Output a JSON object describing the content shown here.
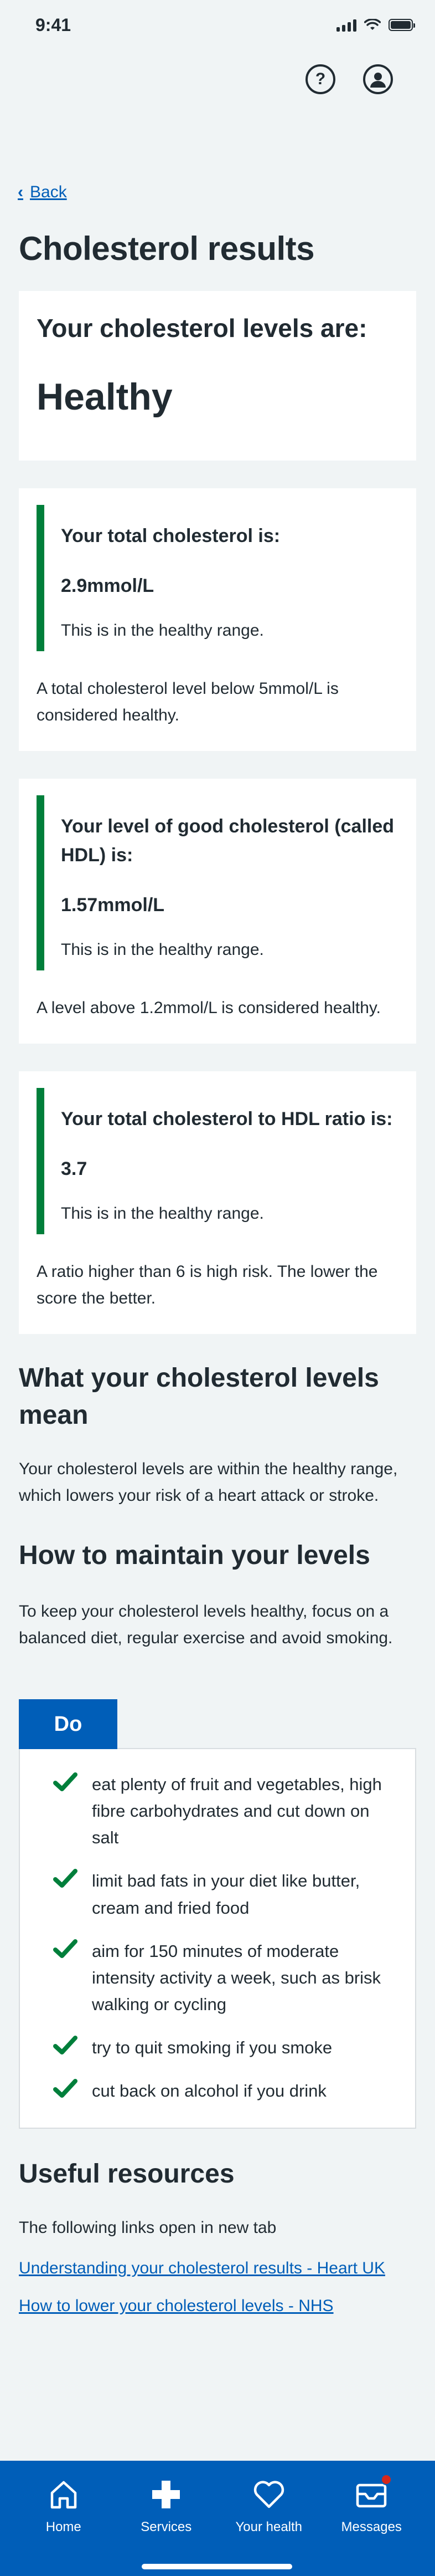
{
  "status_bar": {
    "time": "9:41"
  },
  "header": {
    "help_icon": "question-circle-icon",
    "profile_icon": "user-circle-icon"
  },
  "back": {
    "label": "Back"
  },
  "page_title": "Cholesterol results",
  "summary": {
    "label": "Your cholesterol levels are:",
    "value": "Healthy"
  },
  "results": [
    {
      "title": "Your total cholesterol is:",
      "value": "2.9mmol/L",
      "note": "This is in the healthy range.",
      "footnote": "A total cholesterol level below 5mmol/L is considered healthy."
    },
    {
      "title": "Your level of good cholesterol (called HDL) is:",
      "value": "1.57mmol/L",
      "note": "This is in the healthy range.",
      "footnote": "A level above 1.2mmol/L is considered healthy."
    },
    {
      "title": "Your total cholesterol to HDL ratio is:",
      "value": "3.7",
      "note": "This is in the healthy range.",
      "footnote": "A ratio higher than 6 is high risk. The lower the score the better."
    }
  ],
  "meaning": {
    "heading": "What your cholesterol levels mean",
    "body": "Your cholesterol levels are within the healthy range, which lowers your risk of a heart attack or stroke."
  },
  "maintain": {
    "heading": "How to maintain your levels",
    "body": "To keep your cholesterol levels healthy, focus on a balanced diet, regular exercise and avoid smoking."
  },
  "do_list": {
    "label": "Do",
    "items": [
      "eat plenty of fruit and vegetables, high fibre carbohydrates and cut down on salt",
      "limit bad fats in your diet like butter, cream and fried food",
      "aim for 150 minutes of moderate intensity activity a week, such as brisk walking or cycling",
      "try to quit smoking if you smoke",
      "cut back on alcohol if you drink"
    ]
  },
  "resources": {
    "heading": "Useful resources",
    "intro": "The following links open in new tab",
    "links": [
      "Understanding your cholesterol results - Heart UK",
      "How to lower your cholesterol levels - NHS"
    ]
  },
  "bottom_nav": {
    "items": [
      {
        "label": "Home",
        "icon": "home-icon"
      },
      {
        "label": "Services",
        "icon": "cross-icon"
      },
      {
        "label": "Your health",
        "icon": "heart-icon"
      },
      {
        "label": "Messages",
        "icon": "envelope-icon"
      }
    ]
  },
  "colors": {
    "brand": "#005eb8",
    "success": "#007f3b",
    "background": "#f0f4f5",
    "alert": "#d5281b"
  }
}
